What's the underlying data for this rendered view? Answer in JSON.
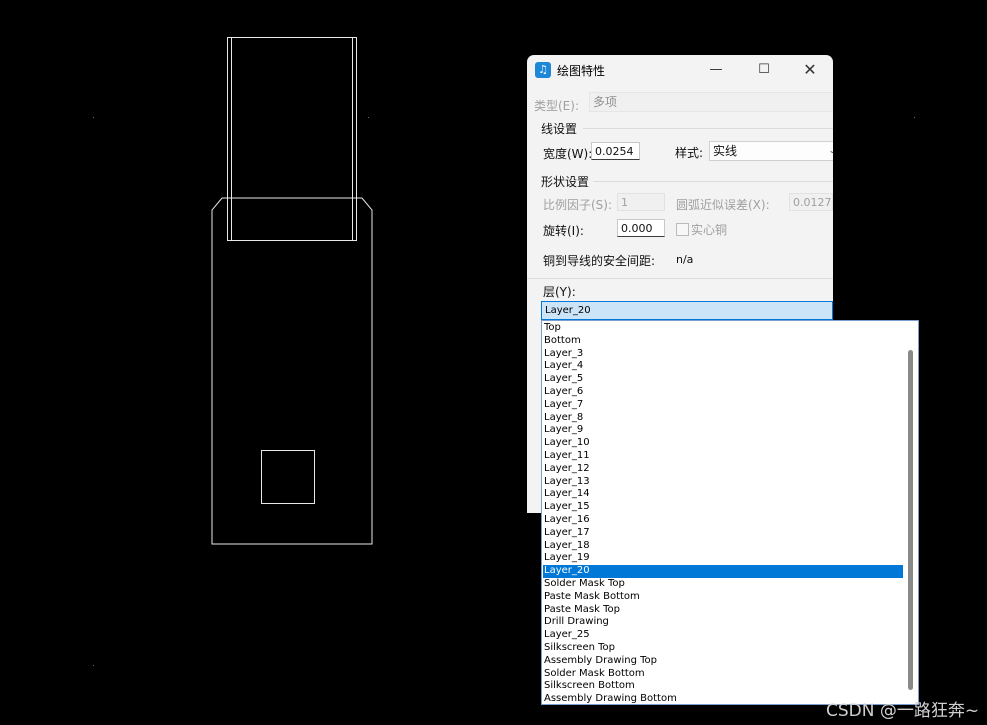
{
  "dialog": {
    "title": "绘图特性",
    "minimize_icon": "minimize-icon",
    "maximize_icon": "maximize-icon",
    "close_icon": "close-icon",
    "type_label": "类型(E):",
    "type_value": "多项",
    "line_section": "线设置",
    "width_label": "宽度(W):",
    "width_value": "0.0254",
    "style_label": "样式:",
    "style_value": "实线",
    "shape_section": "形状设置",
    "scale_label": "比例因子(S):",
    "scale_value": "1",
    "arc_label": "圆弧近似误差(X):",
    "arc_value": "0.0127",
    "rotation_label": "旋转(I):",
    "rotation_value": "0.000",
    "solid_copper_label": "实心铜",
    "clearance_label": "铜到导线的安全间距:",
    "clearance_value": "n/a",
    "layer_label": "层(Y):",
    "layer_value": "Layer_20"
  },
  "layer_dropdown": {
    "items": [
      "Top",
      "Bottom",
      "Layer_3",
      "Layer_4",
      "Layer_5",
      "Layer_6",
      "Layer_7",
      "Layer_8",
      "Layer_9",
      "Layer_10",
      "Layer_11",
      "Layer_12",
      "Layer_13",
      "Layer_14",
      "Layer_15",
      "Layer_16",
      "Layer_17",
      "Layer_18",
      "Layer_19",
      "Layer_20",
      "Solder Mask Top",
      "Paste Mask Bottom",
      "Paste Mask Top",
      "Drill Drawing",
      "Layer_25",
      "Silkscreen Top",
      "Assembly Drawing Top",
      "Solder Mask Bottom",
      "Silkscreen Bottom",
      "Assembly Drawing Bottom"
    ],
    "selected": "Layer_20"
  },
  "watermark": "CSDN @一路狂奔~",
  "colors": {
    "background": "#000000",
    "selection": "#0078d7",
    "outline": "#ffffff"
  }
}
